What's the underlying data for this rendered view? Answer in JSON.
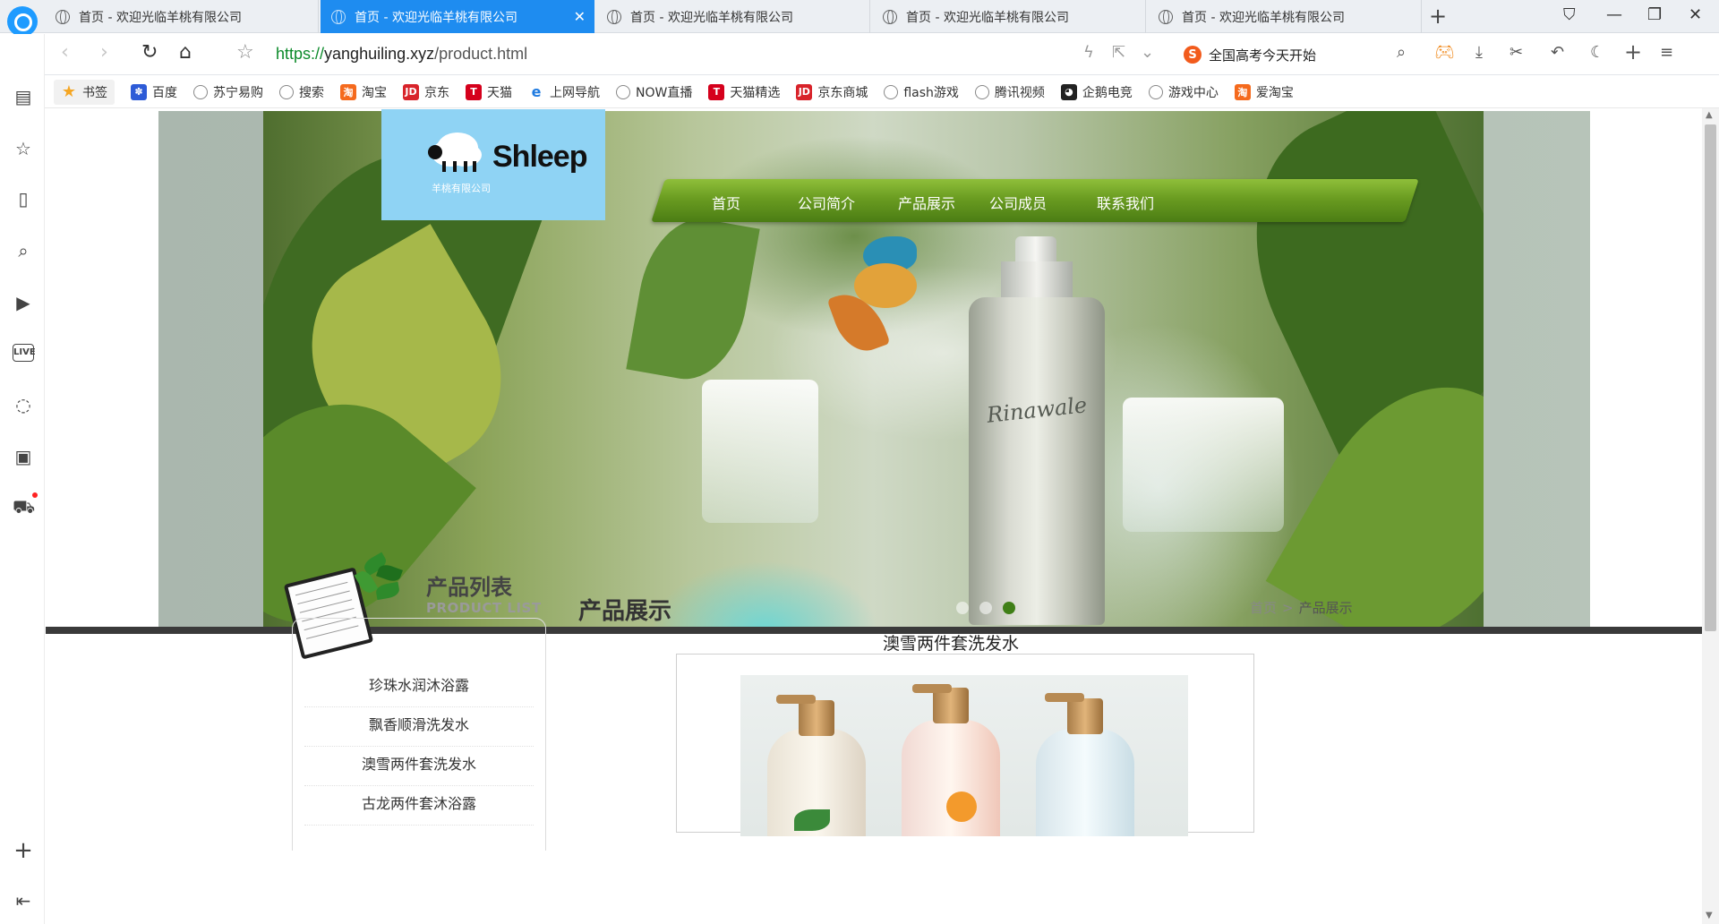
{
  "browser": {
    "tabs": [
      {
        "title": "首页 - 欢迎光临羊桃有限公司",
        "active": false
      },
      {
        "title": "首页 - 欢迎光临羊桃有限公司",
        "active": true
      },
      {
        "title": "首页 - 欢迎光临羊桃有限公司",
        "active": false
      },
      {
        "title": "首页 - 欢迎光临羊桃有限公司",
        "active": false
      },
      {
        "title": "首页 - 欢迎光临羊桃有限公司",
        "active": false
      }
    ],
    "url": {
      "protocol": "https://",
      "host": "yanghuiling.xyz",
      "path": "/product.html"
    },
    "search_text": "全国高考今天开始",
    "bookmarks": [
      {
        "label": "书签",
        "icon": "star-icon"
      },
      {
        "label": "百度",
        "icon": "baidu-icon"
      },
      {
        "label": "苏宁易购",
        "icon": "globe-icon"
      },
      {
        "label": "搜索",
        "icon": "globe-icon"
      },
      {
        "label": "淘宝",
        "icon": "taobao-icon"
      },
      {
        "label": "京东",
        "icon": "jd-icon"
      },
      {
        "label": "天猫",
        "icon": "tmall-icon"
      },
      {
        "label": "上网导航",
        "icon": "ie-icon"
      },
      {
        "label": "NOW直播",
        "icon": "globe-icon"
      },
      {
        "label": "天猫精选",
        "icon": "tmall-icon"
      },
      {
        "label": "京东商城",
        "icon": "jd-icon"
      },
      {
        "label": "flash游戏",
        "icon": "globe-icon"
      },
      {
        "label": "腾讯视频",
        "icon": "globe-icon"
      },
      {
        "label": "企鹅电竞",
        "icon": "penguin-icon"
      },
      {
        "label": "游戏中心",
        "icon": "globe-icon"
      },
      {
        "label": "爱淘宝",
        "icon": "taobao-icon"
      }
    ]
  },
  "site": {
    "logo_text": "Shleep",
    "logo_sub": "羊桃有限公司",
    "nav": [
      "首页",
      "公司简介",
      "产品展示",
      "公司成员",
      "联系我们"
    ],
    "banner": {
      "bottle_brand": "Rinawale",
      "active_dot": 3,
      "dots": 3
    },
    "sidebar": {
      "title": "产品列表",
      "subtitle": "PRODUCT LIST",
      "items": [
        "珍珠水润沐浴露",
        "飘香顺滑洗发水",
        "澳雪两件套洗发水",
        "古龙两件套沐浴露"
      ]
    },
    "content": {
      "title": "产品展示",
      "breadcrumb_home": "首页",
      "breadcrumb_sep": ">",
      "breadcrumb_current": "产品展示",
      "product_name": "澳雪两件套洗发水"
    }
  },
  "colors": {
    "tab_active": "#1e8cf0",
    "logo_bg": "#8fd3f4",
    "nav_green": "#6a9c21",
    "url_protocol": "#0b8a2a"
  }
}
